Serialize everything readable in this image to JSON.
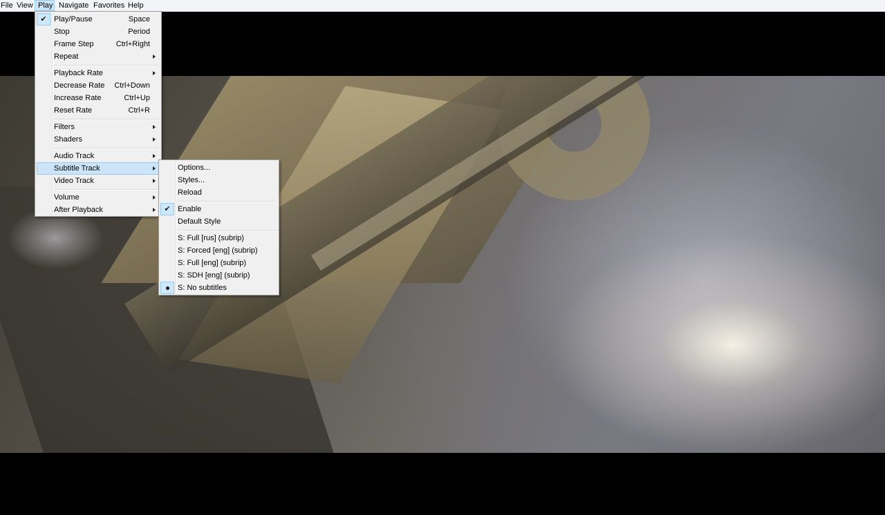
{
  "menubar": {
    "items": [
      "File",
      "View",
      "Play",
      "Navigate",
      "Favorites",
      "Help"
    ]
  },
  "play_menu": {
    "items": [
      {
        "label": "Play/Pause",
        "shortcut": "Space",
        "checked": true
      },
      {
        "label": "Stop",
        "shortcut": "Period"
      },
      {
        "label": "Frame Step",
        "shortcut": "Ctrl+Right"
      },
      {
        "label": "Repeat",
        "submenu": true
      },
      {
        "label": "Playback Rate",
        "submenu": true
      },
      {
        "label": "Decrease Rate",
        "shortcut": "Ctrl+Down"
      },
      {
        "label": "Increase Rate",
        "shortcut": "Ctrl+Up"
      },
      {
        "label": "Reset Rate",
        "shortcut": "Ctrl+R"
      },
      {
        "label": "Filters",
        "submenu": true
      },
      {
        "label": "Shaders",
        "submenu": true
      },
      {
        "label": "Audio Track",
        "submenu": true
      },
      {
        "label": "Subtitle Track",
        "submenu": true,
        "highlighted": true
      },
      {
        "label": "Video Track",
        "submenu": true
      },
      {
        "label": "Volume",
        "submenu": true
      },
      {
        "label": "After Playback",
        "submenu": true
      }
    ]
  },
  "subtitle_menu": {
    "items": [
      {
        "label": "Options..."
      },
      {
        "label": "Styles..."
      },
      {
        "label": "Reload"
      },
      {
        "label": "Enable",
        "checked": true
      },
      {
        "label": "Default Style"
      },
      {
        "label": "S: Full [rus] (subrip)"
      },
      {
        "label": "S: Forced [eng] (subrip)"
      },
      {
        "label": "S: Full [eng] (subrip)"
      },
      {
        "label": "S: SDH [eng] (subrip)"
      },
      {
        "label": "S: No subtitles",
        "selected": true
      }
    ]
  },
  "icons": {
    "check": "check-icon",
    "radio": "radio-dot-icon",
    "submenu_arrow": "submenu-arrow-icon"
  },
  "colors": {
    "menu_bg": "#f0f0f0",
    "highlight": "#cce4f7",
    "highlight_border": "#99c9ef"
  }
}
